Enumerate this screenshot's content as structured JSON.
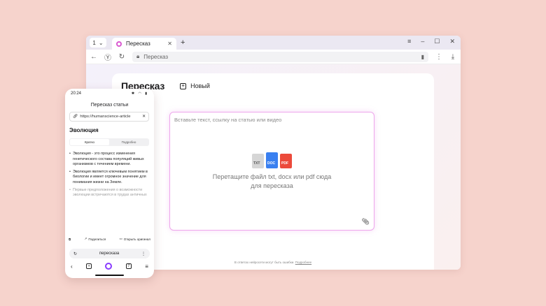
{
  "browser": {
    "tab_counter": "1",
    "tab_title": "Пересказ",
    "address_text": "Пересказ"
  },
  "app": {
    "logo": "Пересказ",
    "new_label": "Новый",
    "placeholder": "Вставьте текст, ссылку на статью или видео",
    "file_types": [
      "TXT",
      "DOC",
      "PDF"
    ],
    "drop_line1": "Перетащите файл txt, docx или pdf сюда",
    "drop_line2": "для пересказа",
    "disclaimer_text": "В ответах нейросети могут быть ошибки.",
    "disclaimer_link": "Подробнее"
  },
  "phone": {
    "time": "20:24",
    "title": "Пересказ статьи",
    "url": "https://humanscience-article",
    "heading": "Эволюция",
    "tab_short": "Кратко",
    "tab_detailed": "Подробно",
    "items": [
      "Эволюция - это процесс изменения генетического состава популяций живых организмов с течением времени.",
      "Эволюция является ключевым понятием в биологии и имеет огромное значение для понимания жизни на Земле.",
      "Первые предположения о возможности эволюции встречаются в трудах античных"
    ],
    "share": "Поделиться",
    "open_original": "Открыть оригинал",
    "search_query": "пересказа"
  },
  "colors": {
    "background": "#f6d3cc",
    "accent": "#eea6ec",
    "alice": "#8a3cff"
  }
}
